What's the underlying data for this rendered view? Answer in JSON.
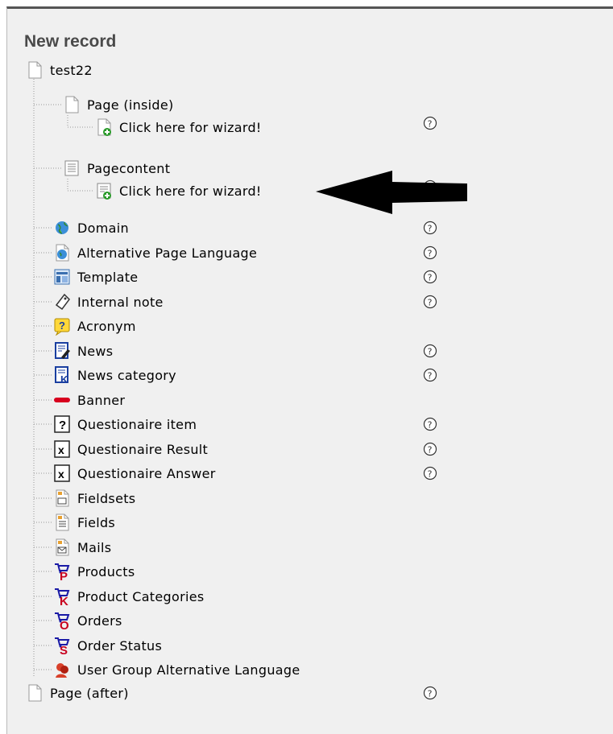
{
  "title": "New record",
  "root": {
    "label": "test22",
    "icon": "page-icon"
  },
  "groups": [
    {
      "label": "Page (inside)",
      "icon": "page-icon",
      "wizard": "Click here for wizard!",
      "wizard_icon": "page-new-icon"
    },
    {
      "label": "Pagecontent",
      "icon": "content-icon",
      "wizard": "Click here for wizard!",
      "wizard_icon": "content-new-icon"
    }
  ],
  "records": [
    {
      "label": "Domain",
      "icon": "globe-icon",
      "help": true
    },
    {
      "label": "Alternative Page Language",
      "icon": "globe-page-icon",
      "help": true
    },
    {
      "label": "Template",
      "icon": "template-icon",
      "help": true
    },
    {
      "label": "Internal note",
      "icon": "tag-icon",
      "help": true
    },
    {
      "label": "Acronym",
      "icon": "acronym-icon",
      "help": false
    },
    {
      "label": "News",
      "icon": "news-icon",
      "help": true
    },
    {
      "label": "News category",
      "icon": "news-category-icon",
      "help": true
    },
    {
      "label": "Banner",
      "icon": "banner-icon",
      "help": false
    },
    {
      "label": "Questionaire item",
      "icon": "question-box-icon",
      "help": true
    },
    {
      "label": "Questionaire Result",
      "icon": "x-box-icon",
      "help": true
    },
    {
      "label": "Questionaire Answer",
      "icon": "x-box-icon",
      "help": true
    },
    {
      "label": "Fieldsets",
      "icon": "fieldset-icon",
      "help": false
    },
    {
      "label": "Fields",
      "icon": "field-icon",
      "help": false
    },
    {
      "label": "Mails",
      "icon": "mail-icon",
      "help": false
    },
    {
      "label": "Products",
      "icon": "cart-p-icon",
      "help": false
    },
    {
      "label": "Product Categories",
      "icon": "cart-k-icon",
      "help": false
    },
    {
      "label": "Orders",
      "icon": "cart-o-icon",
      "help": false
    },
    {
      "label": "Order Status",
      "icon": "cart-s-icon",
      "help": false
    },
    {
      "label": "User Group Alternative Language",
      "icon": "user-group-icon",
      "help": false
    }
  ],
  "after": {
    "label": "Page (after)",
    "icon": "page-icon",
    "help": true
  },
  "help_glyph": "?",
  "colors": {
    "cart_blue": "#1a1aa6",
    "cart_red": "#c8001e",
    "banner_red": "#d8001e",
    "title": "#4a4a4a"
  }
}
